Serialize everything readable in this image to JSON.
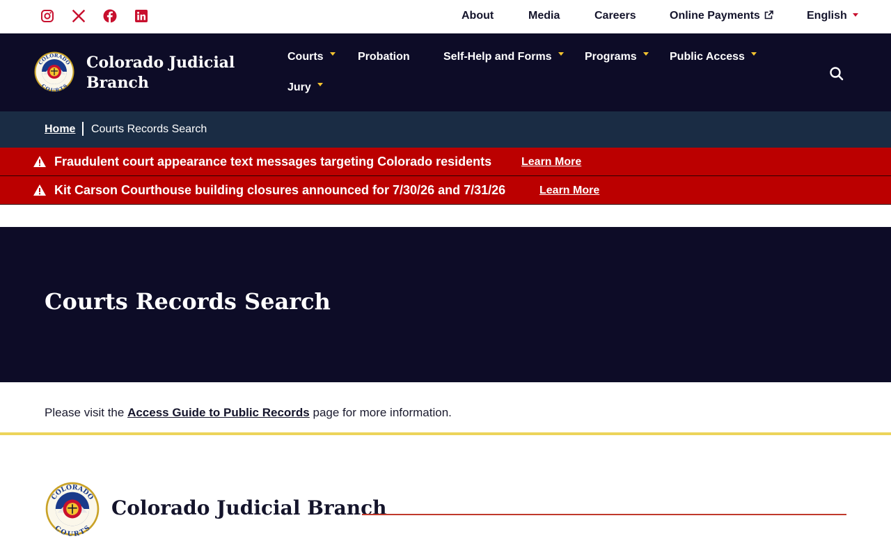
{
  "utility": {
    "social": [
      {
        "icon": "instagram-icon"
      },
      {
        "icon": "x-twitter-icon"
      },
      {
        "icon": "facebook-icon"
      },
      {
        "icon": "linkedin-icon"
      }
    ],
    "links": {
      "about": "About",
      "media": "Media",
      "careers": "Careers",
      "payments": "Online Payments",
      "language": "English"
    }
  },
  "nav": {
    "brand": "Colorado Judicial Branch",
    "items": {
      "courts": "Courts",
      "probation": "Probation",
      "selfhelp": "Self-Help and Forms",
      "programs": "Programs",
      "public_access": "Public Access",
      "jury": "Jury"
    }
  },
  "breadcrumb": {
    "home": "Home",
    "current": "Courts Records Search"
  },
  "alerts": [
    {
      "text": "Fraudulent court appearance text messages targeting Colorado residents",
      "link": "Learn More"
    },
    {
      "text": "Kit Carson Courthouse building closures announced for 7/30/26 and 7/31/26",
      "link": "Learn More"
    }
  ],
  "hero": {
    "title": "Courts Records Search"
  },
  "info": {
    "before": "Please visit the ",
    "link": "Access Guide to Public Records",
    "after": " page for more information."
  },
  "footer": {
    "brand": "Colorado Judicial Branch"
  },
  "seal": {
    "top_text": "COLORADO",
    "bottom_text": "COURTS"
  },
  "colors": {
    "navy": "#0d0c27",
    "breadcrumb_bg": "#1a2c44",
    "alert_red": "#bb0000",
    "accent_red": "#c8102e",
    "accent_yellow": "#f4c430",
    "rule_yellow": "#ecd45a"
  }
}
